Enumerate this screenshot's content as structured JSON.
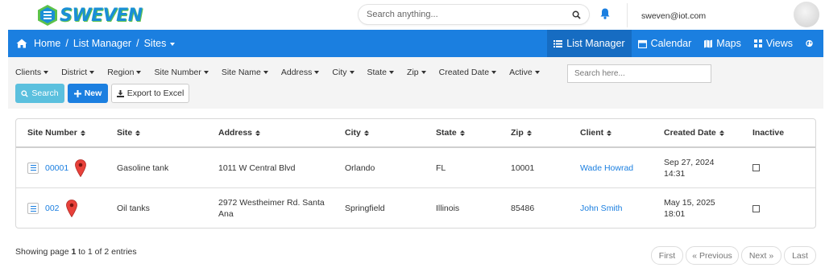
{
  "header": {
    "logo_text": "SWEVEN",
    "search_placeholder": "Search anything...",
    "user_email": "sweven@iot.com",
    "brand_color": "#1b7fe0"
  },
  "nav": {
    "breadcrumb": [
      "Home",
      "List Manager",
      "Sites"
    ],
    "items": [
      {
        "label": "List Manager",
        "icon": "list-icon",
        "active": true
      },
      {
        "label": "Calendar",
        "icon": "calendar-icon",
        "active": false
      },
      {
        "label": "Maps",
        "icon": "map-icon",
        "active": false
      },
      {
        "label": "Views",
        "icon": "views-icon",
        "active": false
      }
    ]
  },
  "filters": {
    "items": [
      "Clients",
      "District",
      "Region",
      "Site Number",
      "Site Name",
      "Address",
      "City",
      "State",
      "Zip",
      "Created Date",
      "Active"
    ],
    "search_placeholder": "Search here...",
    "search_button": "Search",
    "new_button": "New",
    "export_button": "Export to Excel"
  },
  "table": {
    "columns": [
      "Site Number",
      "Site",
      "Address",
      "City",
      "State",
      "Zip",
      "Client",
      "Created Date",
      "Inactive"
    ],
    "rows": [
      {
        "site_number": "00001",
        "site": "Gasoline tank",
        "address": "1011 W Central Blvd",
        "city": "Orlando",
        "state": "FL",
        "zip": "10001",
        "client": "Wade Howrad",
        "created_date": "Sep 27, 2024",
        "created_time": "14:31",
        "inactive": false
      },
      {
        "site_number": "002",
        "site": "Oil tanks",
        "address": "2972 Westheimer Rd. Santa Ana",
        "city": "Springfield",
        "state": "Illinois",
        "zip": "85486",
        "client": "John Smith",
        "created_date": "May 15, 2025",
        "created_time": "18:01",
        "inactive": false
      }
    ]
  },
  "footer": {
    "showing_prefix": "Showing page ",
    "page": "1",
    "showing_middle": " to ",
    "total_pages": "1",
    "showing_suffix": " of 2 entries",
    "pager": {
      "first": "First",
      "previous": "« Previous",
      "next": "Next »",
      "last": "Last"
    }
  }
}
